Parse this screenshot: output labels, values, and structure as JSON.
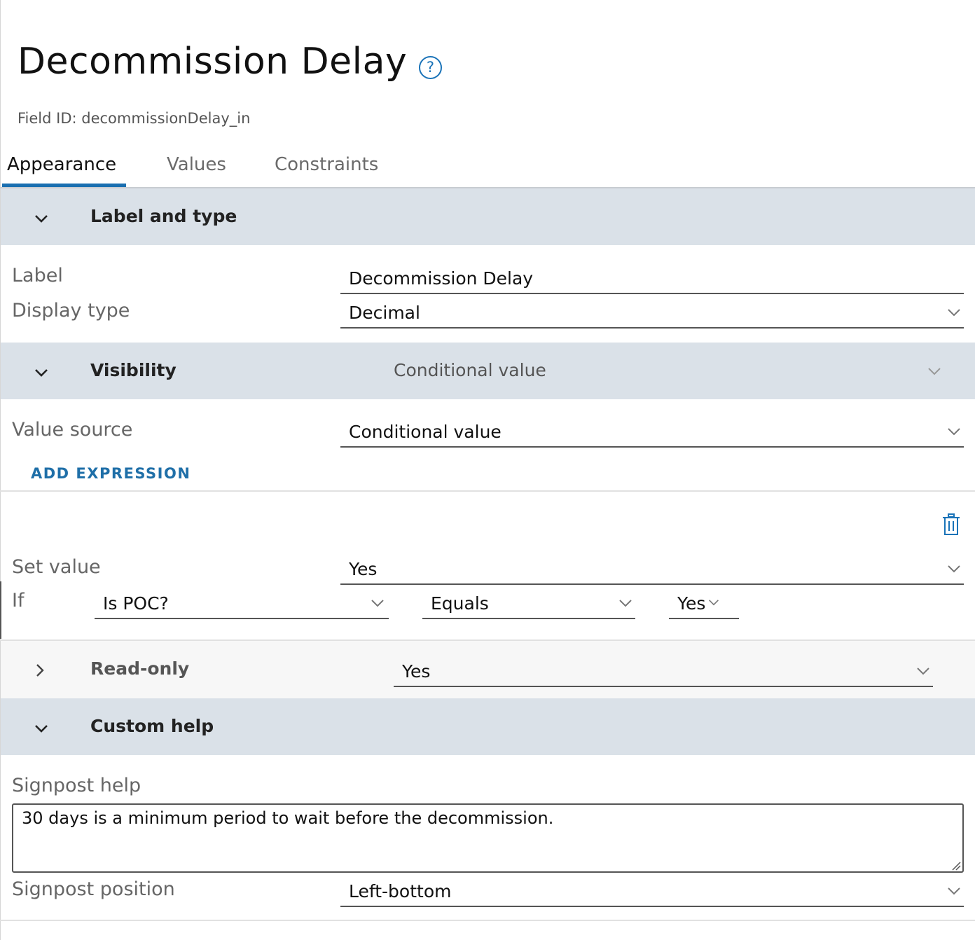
{
  "header": {
    "title": "Decommission Delay",
    "field_id": "Field ID: decommissionDelay_in"
  },
  "tabs": [
    {
      "label": "Appearance",
      "active": true
    },
    {
      "label": "Values",
      "active": false
    },
    {
      "label": "Constraints",
      "active": false
    }
  ],
  "label_and_type": {
    "title": "Label and type",
    "label_label": "Label",
    "label_value": "Decommission Delay",
    "display_type_label": "Display type",
    "display_type_value": "Decimal"
  },
  "visibility": {
    "title": "Visibility",
    "header_value": "Conditional value",
    "value_source_label": "Value source",
    "value_source_value": "Conditional value",
    "add_expression": "ADD EXPRESSION",
    "set_value_label": "Set value",
    "set_value": "Yes",
    "if_label": "If",
    "if_field": "Is POC?",
    "if_operator": "Equals",
    "if_value": "Yes"
  },
  "read_only": {
    "title": "Read-only",
    "value": "Yes"
  },
  "custom_help": {
    "title": "Custom help",
    "signpost_help_label": "Signpost help",
    "signpost_help_value": "30 days is a minimum period to wait before the decommission.",
    "signpost_position_label": "Signpost position",
    "signpost_position_value": "Left-bottom"
  },
  "colors": {
    "accent": "#1a6fb0",
    "section_bg": "#dae1e8",
    "link": "#1f6fa8"
  },
  "icons": [
    "help-circle-icon",
    "chevron-down-icon",
    "chevron-right-icon",
    "trash-icon",
    "resize-handle-icon"
  ]
}
